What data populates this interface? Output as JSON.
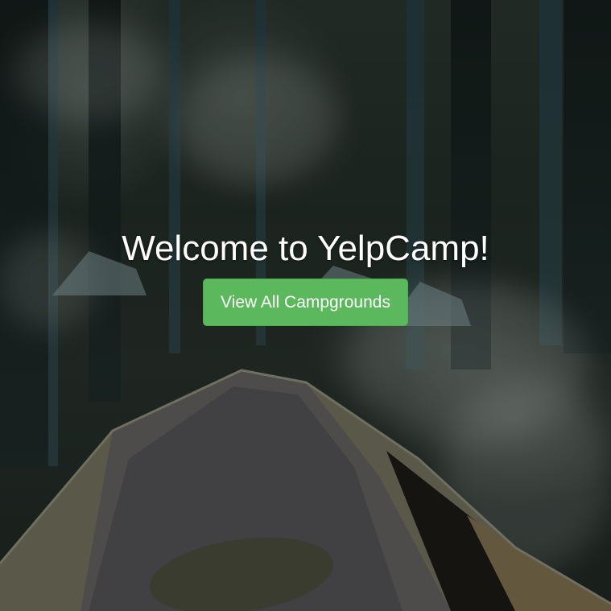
{
  "hero": {
    "title": "Welcome to YelpCamp!",
    "cta_label": "View All Campgrounds"
  },
  "colors": {
    "button_bg": "#5cb85c",
    "title_text": "#ffffff"
  }
}
